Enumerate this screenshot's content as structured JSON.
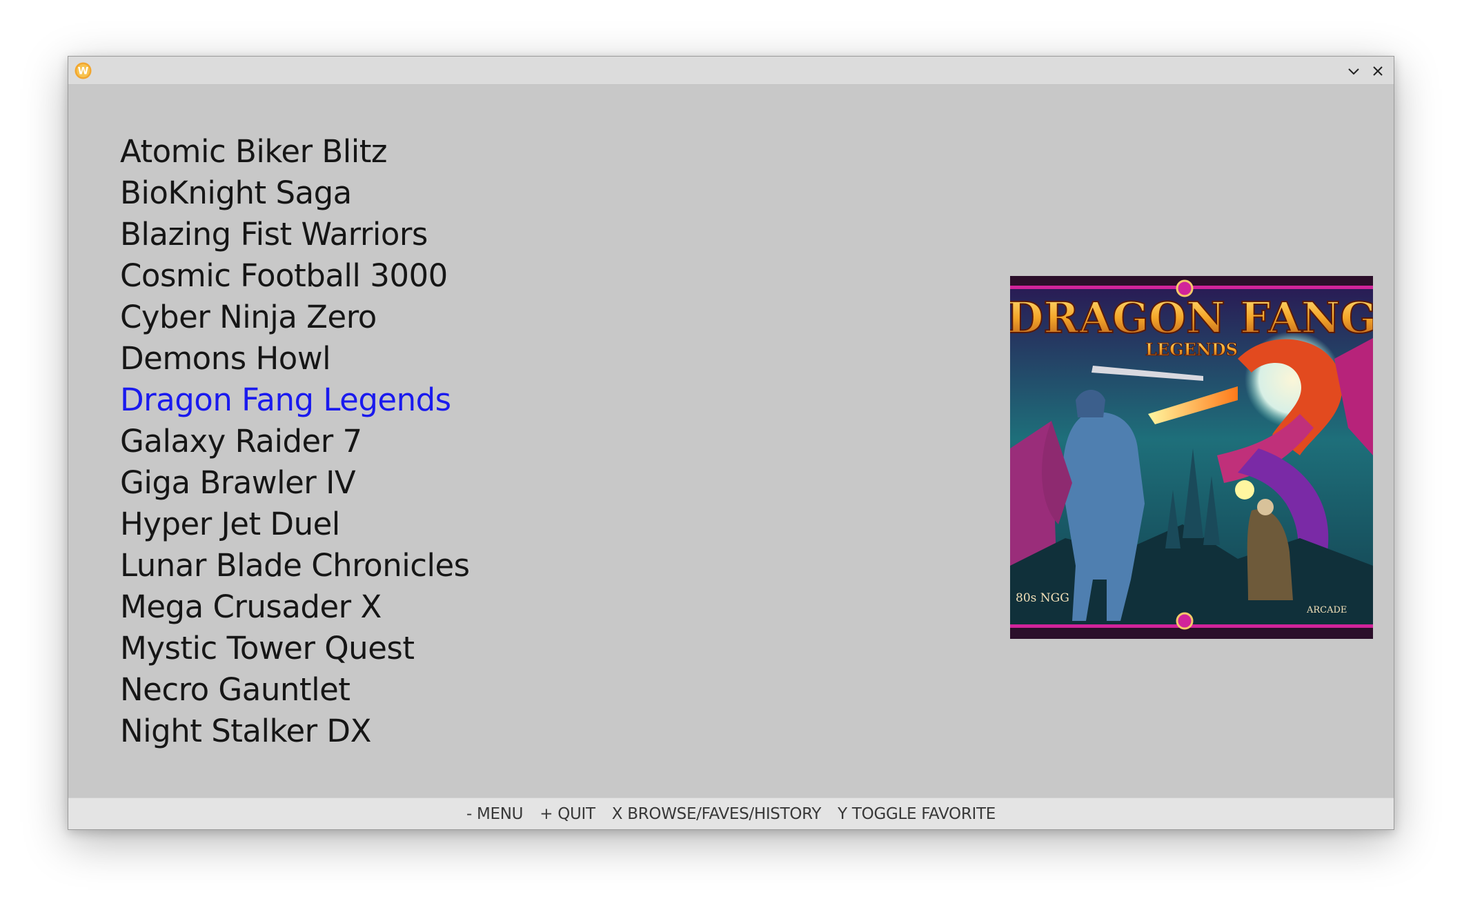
{
  "window": {
    "app_icon_letter": "W",
    "controls": {
      "minimize_icon": "chevron-down-icon",
      "close_icon": "close-icon"
    }
  },
  "games": [
    "Atomic Biker Blitz",
    "BioKnight Saga",
    "Blazing Fist Warriors",
    "Cosmic Football 3000",
    "Cyber Ninja Zero",
    "Demons Howl",
    "Dragon Fang Legends",
    "Galaxy Raider 7",
    "Giga Brawler IV",
    "Hyper Jet Duel",
    "Lunar Blade Chronicles",
    "Mega Crusader X",
    "Mystic Tower Quest",
    "Necro Gauntlet",
    "Night Stalker DX"
  ],
  "selected_game": "Dragon Fang Legends",
  "boxart": {
    "title": "DRAGON FANG",
    "subtitle": "LEGENDS",
    "corner_text": "80s NGG",
    "publisher_text": "ARCADE"
  },
  "footer": {
    "menu": "- MENU",
    "quit": "+ QUIT",
    "browse": "X BROWSE/FAVES/HISTORY",
    "favorite": "Y TOGGLE FAVORITE"
  },
  "colors": {
    "background": "#c8c8c8",
    "titlebar": "#dcdcdc",
    "footer": "#e4e4e4",
    "text": "#161616",
    "selected": "#1a1aee",
    "app_icon": "#f2a62e"
  }
}
